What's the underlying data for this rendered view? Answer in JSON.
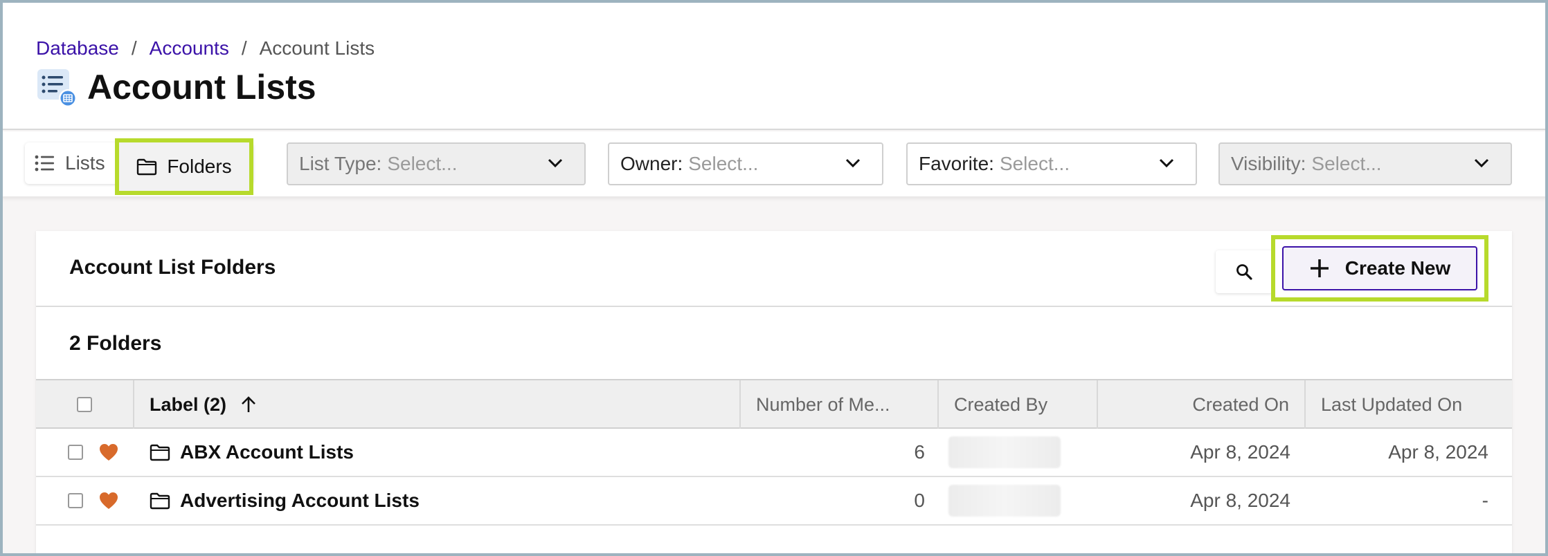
{
  "breadcrumb": {
    "items": [
      "Database",
      "Accounts",
      "Account Lists"
    ],
    "separator": "/"
  },
  "page": {
    "title": "Account Lists",
    "icon": "list-icon"
  },
  "toolbar": {
    "view_toggle": {
      "lists_label": "Lists",
      "folders_label": "Folders",
      "active": "Folders"
    },
    "filters": [
      {
        "label": "List Type:",
        "placeholder": "Select...",
        "disabled": true
      },
      {
        "label": "Owner:",
        "placeholder": "Select...",
        "disabled": false
      },
      {
        "label": "Favorite:",
        "placeholder": "Select...",
        "disabled": false
      },
      {
        "label": "Visibility:",
        "placeholder": "Select...",
        "disabled": true
      }
    ]
  },
  "card": {
    "title": "Account List Folders",
    "create_label": "Create New",
    "count_label": "2 Folders"
  },
  "table": {
    "columns": {
      "label": "Label (2)",
      "members": "Number of Me...",
      "created_by": "Created By",
      "created_on": "Created On",
      "updated_on": "Last Updated On"
    },
    "sort": {
      "column": "label",
      "direction": "ascending"
    },
    "rows": [
      {
        "name": "ABX Account Lists",
        "members": "6",
        "created_on": "Apr 8, 2024",
        "updated_on": "Apr 8, 2024",
        "favorite": true
      },
      {
        "name": "Advertising Account Lists",
        "members": "0",
        "created_on": "Apr 8, 2024",
        "updated_on": "-",
        "favorite": true
      }
    ]
  },
  "colors": {
    "accent": "#3b12a8",
    "highlight": "#b7da2c",
    "favorite": "#d86a2b",
    "icon_blue": "#4a90e2"
  }
}
